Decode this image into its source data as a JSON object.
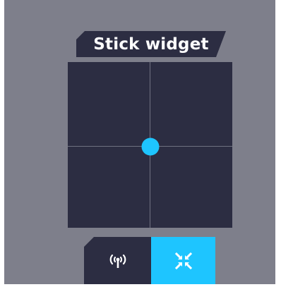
{
  "widget": {
    "title": "Stick widget"
  },
  "stick": {
    "x": 0.0,
    "y": 0.0
  },
  "buttons": [
    {
      "icon": "signal-tower-icon",
      "active": false
    },
    {
      "icon": "compress-arrows-icon",
      "active": true
    }
  ],
  "colors": {
    "panel_background": "#7e7f8b",
    "dark": "#2c2d42",
    "accent": "#1ec5ff",
    "axis": "#6f7180"
  }
}
